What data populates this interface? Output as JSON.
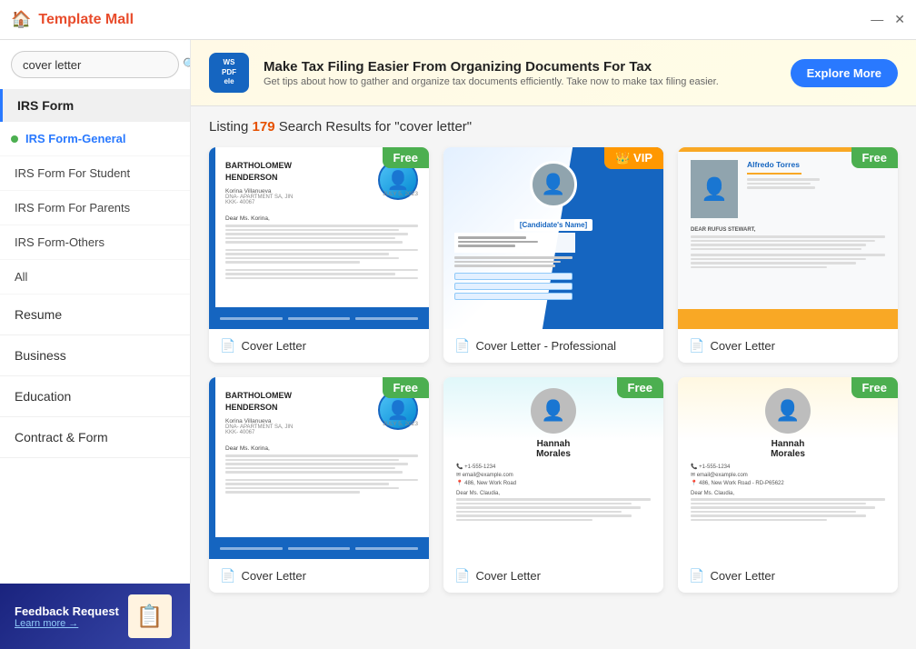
{
  "titleBar": {
    "title": "Template Mall",
    "homeIcon": "🏠",
    "controls": {
      "minimize": "—",
      "close": "✕"
    }
  },
  "search": {
    "placeholder": "cover letter",
    "value": "cover letter"
  },
  "sidebar": {
    "activeSection": "IRS Form",
    "sections": [
      {
        "id": "irs-form",
        "label": "IRS Form",
        "items": [
          {
            "id": "irs-general",
            "label": "IRS Form-General",
            "hasIcon": true
          },
          {
            "id": "irs-student",
            "label": "IRS Form For Student"
          },
          {
            "id": "irs-parents",
            "label": "IRS Form For Parents"
          },
          {
            "id": "irs-others",
            "label": "IRS Form-Others"
          },
          {
            "id": "all",
            "label": "All"
          }
        ]
      }
    ],
    "mainItems": [
      {
        "id": "resume",
        "label": "Resume"
      },
      {
        "id": "business",
        "label": "Business"
      },
      {
        "id": "education",
        "label": "Education"
      },
      {
        "id": "contract-form",
        "label": "Contract & Form"
      }
    ],
    "feedback": {
      "title": "Feedback Request",
      "link": "Learn more →",
      "emoji": "📋"
    }
  },
  "adBanner": {
    "logoText": "WS PDFelement",
    "title": "Make Tax Filing Easier",
    "titleSuffix": " From Organizing Documents For Tax",
    "subtitle": "Get tips about how to gather and organize tax documents efficiently. Take now to make tax filing easier.",
    "buttonLabel": "Explore More"
  },
  "results": {
    "heading": "Listing",
    "count": "179",
    "suffix": " Search Results for \"cover letter\""
  },
  "templates": [
    {
      "id": 1,
      "title": "Cover Letter",
      "badge": "Free",
      "badgeType": "free",
      "style": "cv1"
    },
    {
      "id": 2,
      "title": "Cover Letter - Professional",
      "badge": "VIP",
      "badgeType": "vip",
      "style": "cv2"
    },
    {
      "id": 3,
      "title": "Cover Letter",
      "badge": "Free",
      "badgeType": "free",
      "style": "cv3"
    },
    {
      "id": 4,
      "title": "Cover Letter",
      "badge": "Free",
      "badgeType": "free",
      "style": "cv1"
    },
    {
      "id": 5,
      "title": "Cover Letter",
      "badge": "Free",
      "badgeType": "free",
      "style": "hm"
    },
    {
      "id": 6,
      "title": "Cover Letter",
      "badge": "Free",
      "badgeType": "free",
      "style": "hm2"
    }
  ]
}
